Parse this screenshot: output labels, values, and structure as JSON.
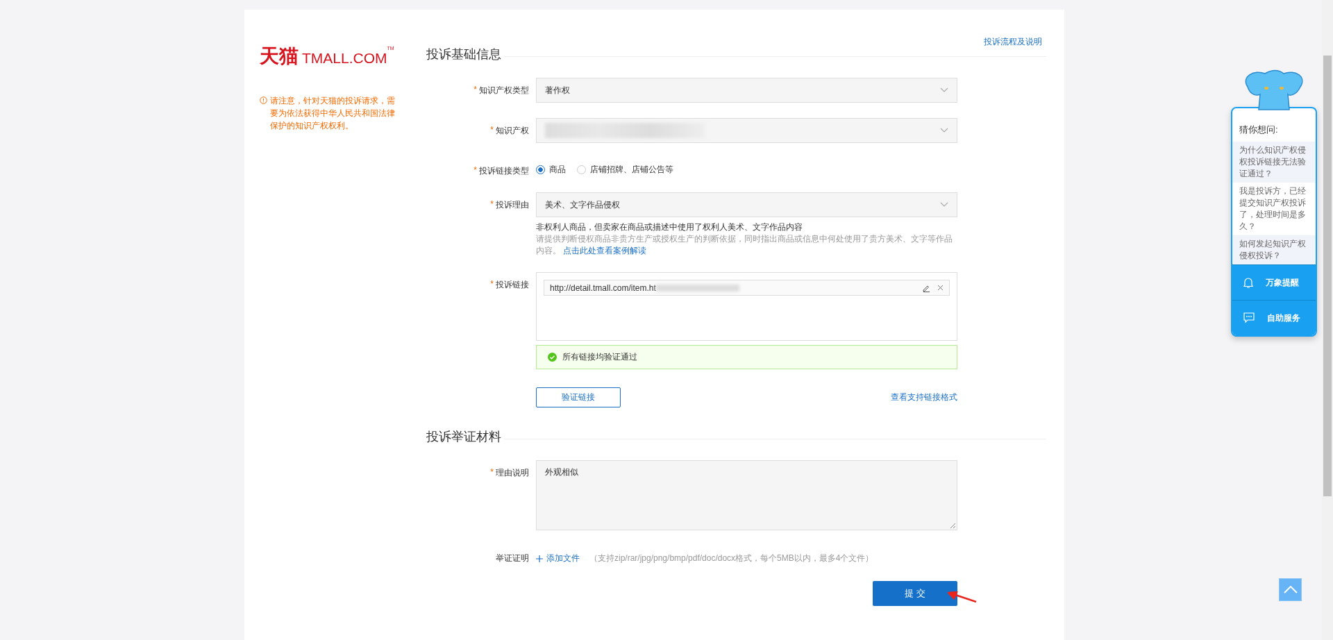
{
  "logo": {
    "cn": "天猫",
    "en": "TMALL.COM",
    "tm": "TM"
  },
  "notice": "请注意，针对天猫的投诉请求，需要为依法获得中华人民共和国法律保护的知识产权权利。",
  "help_link": "投诉流程及说明",
  "required_mark": "*",
  "section_basic": {
    "title": "投诉基础信息"
  },
  "fields": [
    {
      "kind": "select",
      "required": true,
      "label": "知识产权类型",
      "value": "著作权"
    },
    {
      "kind": "select",
      "required": true,
      "label": "知识产权",
      "value_redacted": true
    },
    {
      "kind": "radio",
      "required": true,
      "label": "投诉链接类型",
      "options": [
        {
          "label": "商品",
          "selected": true
        },
        {
          "label": "店铺招牌、店铺公告等",
          "selected": false
        }
      ]
    },
    {
      "kind": "select",
      "required": true,
      "label": "投诉理由",
      "value": "美术、文字作品侵权",
      "hint_title": "非权利人商品，但卖家在商品或描述中使用了权利人美术、文字作品内容",
      "hint": "请提供判断侵权商品非贵方生产或授权生产的判断依据，同时指出商品或信息中何处使用了贵方美术、文字等作品内容。",
      "hint_link": "点击此处查看案例解读"
    },
    {
      "kind": "links",
      "required": true,
      "label": "投诉链接",
      "links": [
        "http://detail.tmall.com/item.ht"
      ],
      "status": "所有链接均验证通过",
      "verify_button": "验证链接",
      "format_link": "查看支持链接格式"
    }
  ],
  "section_evidence": {
    "title": "投诉举证材料"
  },
  "evidence_fields": [
    {
      "kind": "textarea",
      "required": true,
      "label": "理由说明",
      "value": "外观相似"
    },
    {
      "kind": "upload",
      "required": false,
      "label": "举证证明",
      "action": "添加文件",
      "note": "（支持zip/rar/jpg/png/bmp/pdf/doc/docx格式，每个5MB以内，最多4个文件）"
    }
  ],
  "submit": "提 交",
  "assistant": {
    "title": "猜你想问:",
    "questions": [
      "为什么知识产权侵权投诉链接无法验证通过？",
      "我是投诉方，已经提交知识产权投诉了，处理时间是多久？",
      "如何发起知识产权侵权投诉？"
    ],
    "actions": [
      {
        "kind": "bell",
        "label": "万象提醒"
      },
      {
        "kind": "chat",
        "label": "自助服务"
      }
    ]
  }
}
